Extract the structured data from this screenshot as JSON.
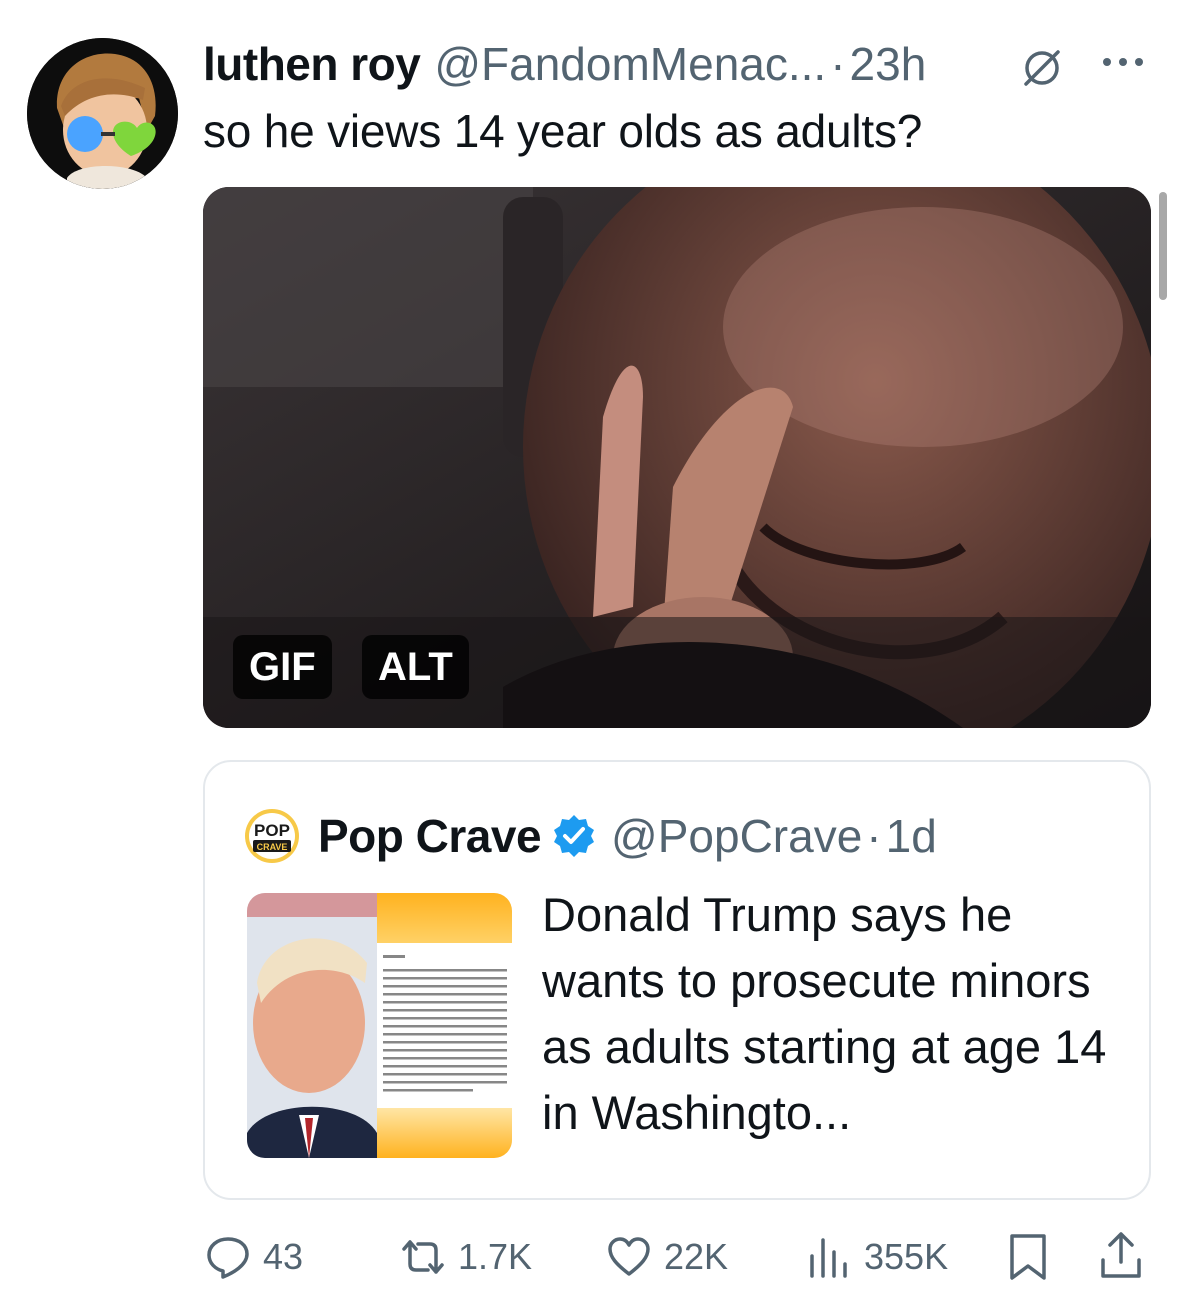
{
  "author": {
    "display_name": "luthen roy",
    "handle": "@FandomMenac...",
    "separator": "·",
    "time": "23h",
    "avatar_icon": "avatar-cartoon-glasses"
  },
  "tweet": {
    "text": "so he views 14 year olds as adults?",
    "media": {
      "type_badge": "GIF",
      "alt_badge": "ALT"
    }
  },
  "quote": {
    "display_name": "Pop Crave",
    "handle": "@PopCrave",
    "separator": "·",
    "time": "1d",
    "verified": true,
    "logo_text": "POP CRAVE",
    "text": "Donald Trump says he wants to prosecute minors as adults starting at age 14 in Washingto..."
  },
  "actions": {
    "replies": "43",
    "reposts": "1.7K",
    "likes": "22K",
    "views": "355K"
  },
  "colors": {
    "text_primary": "#0f1419",
    "text_secondary": "#536471",
    "border": "#e4e8ec",
    "verified": "#1d9bf0"
  }
}
